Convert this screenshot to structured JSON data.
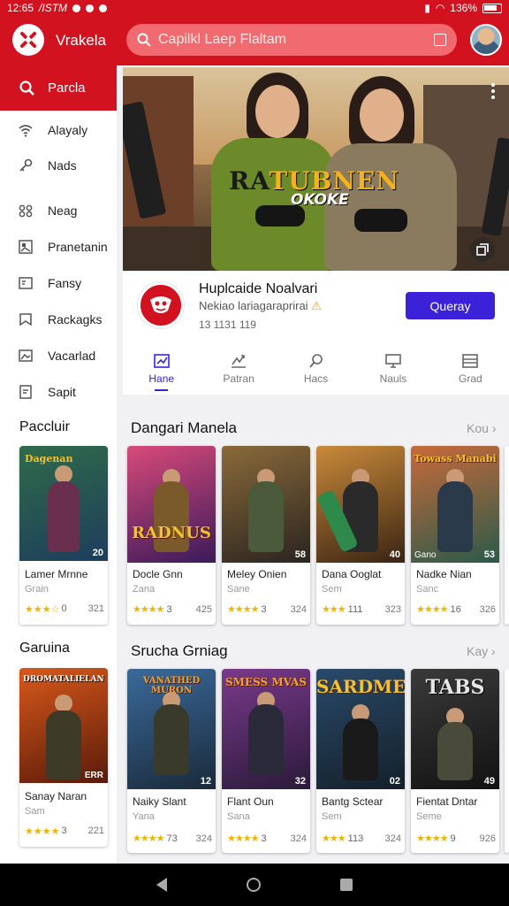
{
  "status": {
    "time": "12:65",
    "carrier": "/ISTM",
    "battery": "136%"
  },
  "app": {
    "name": "Vrakela"
  },
  "search": {
    "placeholder": "Capilkl Laep Flaltam"
  },
  "sidebar": {
    "active": {
      "label": "Parcla",
      "icon": "search-icon"
    },
    "items": [
      {
        "label": "Alayaly",
        "icon": "wifi-icon"
      },
      {
        "label": "Nads",
        "icon": "key-icon"
      },
      {
        "label": "Neag",
        "icon": "infinity-icon"
      },
      {
        "label": "Pranetanin",
        "icon": "image-icon"
      },
      {
        "label": "Fansy",
        "icon": "frame-icon"
      },
      {
        "label": "Rackagks",
        "icon": "bookmark-icon"
      },
      {
        "label": "Vacarlad",
        "icon": "photo-icon"
      },
      {
        "label": "Sapit",
        "icon": "page-icon"
      }
    ],
    "sections": [
      {
        "title": "Paccluir",
        "card": {
          "art": "Dagenan",
          "badge": "20",
          "name": "Lamer Mrnne",
          "sub": "Grain",
          "stars": "★★★☆",
          "score": "0",
          "count": "321"
        }
      },
      {
        "title": "Garuina",
        "card": {
          "art": "DROMATALIELAN",
          "badge": "ERR",
          "name": "Sanay Naran",
          "sub": "Sam",
          "stars": "★★★★",
          "score": "3",
          "count": "221"
        }
      }
    ]
  },
  "hero": {
    "title_dark": "RA",
    "title_yellow": "TUBNEN",
    "subtitle": "OKOKE"
  },
  "game": {
    "title": "Huplcaide Noalvari",
    "developer": "Nekiao lariagaraprirai",
    "stats": "13 1131 119",
    "action_label": "Queray"
  },
  "tabs": [
    {
      "label": "Hane",
      "icon": "home-chart-icon",
      "active": true
    },
    {
      "label": "Patran",
      "icon": "trending-icon",
      "active": false
    },
    {
      "label": "Hacs",
      "icon": "search-icon",
      "active": false
    },
    {
      "label": "Nauls",
      "icon": "monitor-icon",
      "active": false
    },
    {
      "label": "Grad",
      "icon": "list-icon",
      "active": false
    }
  ],
  "sections": [
    {
      "title": "Dangari Manela",
      "more": "Kou",
      "cards": [
        {
          "art": "RADNUS",
          "badge": "",
          "label": "",
          "name": "Docle Gnn",
          "sub": "Zana",
          "stars": "★★★★",
          "score": "3",
          "count": "425",
          "bg": "#b33a5e"
        },
        {
          "art": "",
          "badge": "58",
          "label": "",
          "name": "Meley Onien",
          "sub": "Sane",
          "stars": "★★★★",
          "score": "3",
          "count": "324",
          "bg": "#6b5a3a"
        },
        {
          "art": "",
          "badge": "40",
          "label": "",
          "name": "Dana Ooglat",
          "sub": "Sem",
          "stars": "★★★",
          "score": "111",
          "count": "323",
          "bg": "#7a4f2a"
        },
        {
          "art": "Towass Manabi",
          "badge": "53",
          "label": "Gano",
          "name": "Nadke Nian",
          "sub": "Sanc",
          "stars": "★★★★",
          "score": "16",
          "count": "326",
          "bg": "#3d7a5a"
        }
      ]
    },
    {
      "title": "Srucha Grniag",
      "more": "Kay",
      "cards": [
        {
          "art": "VANATHED MURON",
          "badge": "12",
          "label": "",
          "name": "Naiky Slant",
          "sub": "Yana",
          "stars": "★★★★",
          "score": "73",
          "count": "324",
          "bg": "#2f4f6e"
        },
        {
          "art": "SMESS MVAS",
          "badge": "32",
          "label": "",
          "name": "Flant Oun",
          "sub": "Sana",
          "stars": "★★★★",
          "score": "3",
          "count": "324",
          "bg": "#5a3a6e"
        },
        {
          "art": "SARDME",
          "badge": "02",
          "label": "",
          "name": "Bantg Sctear",
          "sub": "Sem",
          "stars": "★★★",
          "score": "113",
          "count": "324",
          "bg": "#2a3d52"
        },
        {
          "art": "TABS",
          "badge": "49",
          "label": "",
          "name": "Fientat Dntar",
          "sub": "Seme",
          "stars": "★★★★",
          "score": "9",
          "count": "926",
          "bg": "#2e2e2e"
        }
      ]
    }
  ],
  "colors": {
    "brand": "#d3121f",
    "accent": "#3b22d8",
    "star": "#f0b400"
  }
}
